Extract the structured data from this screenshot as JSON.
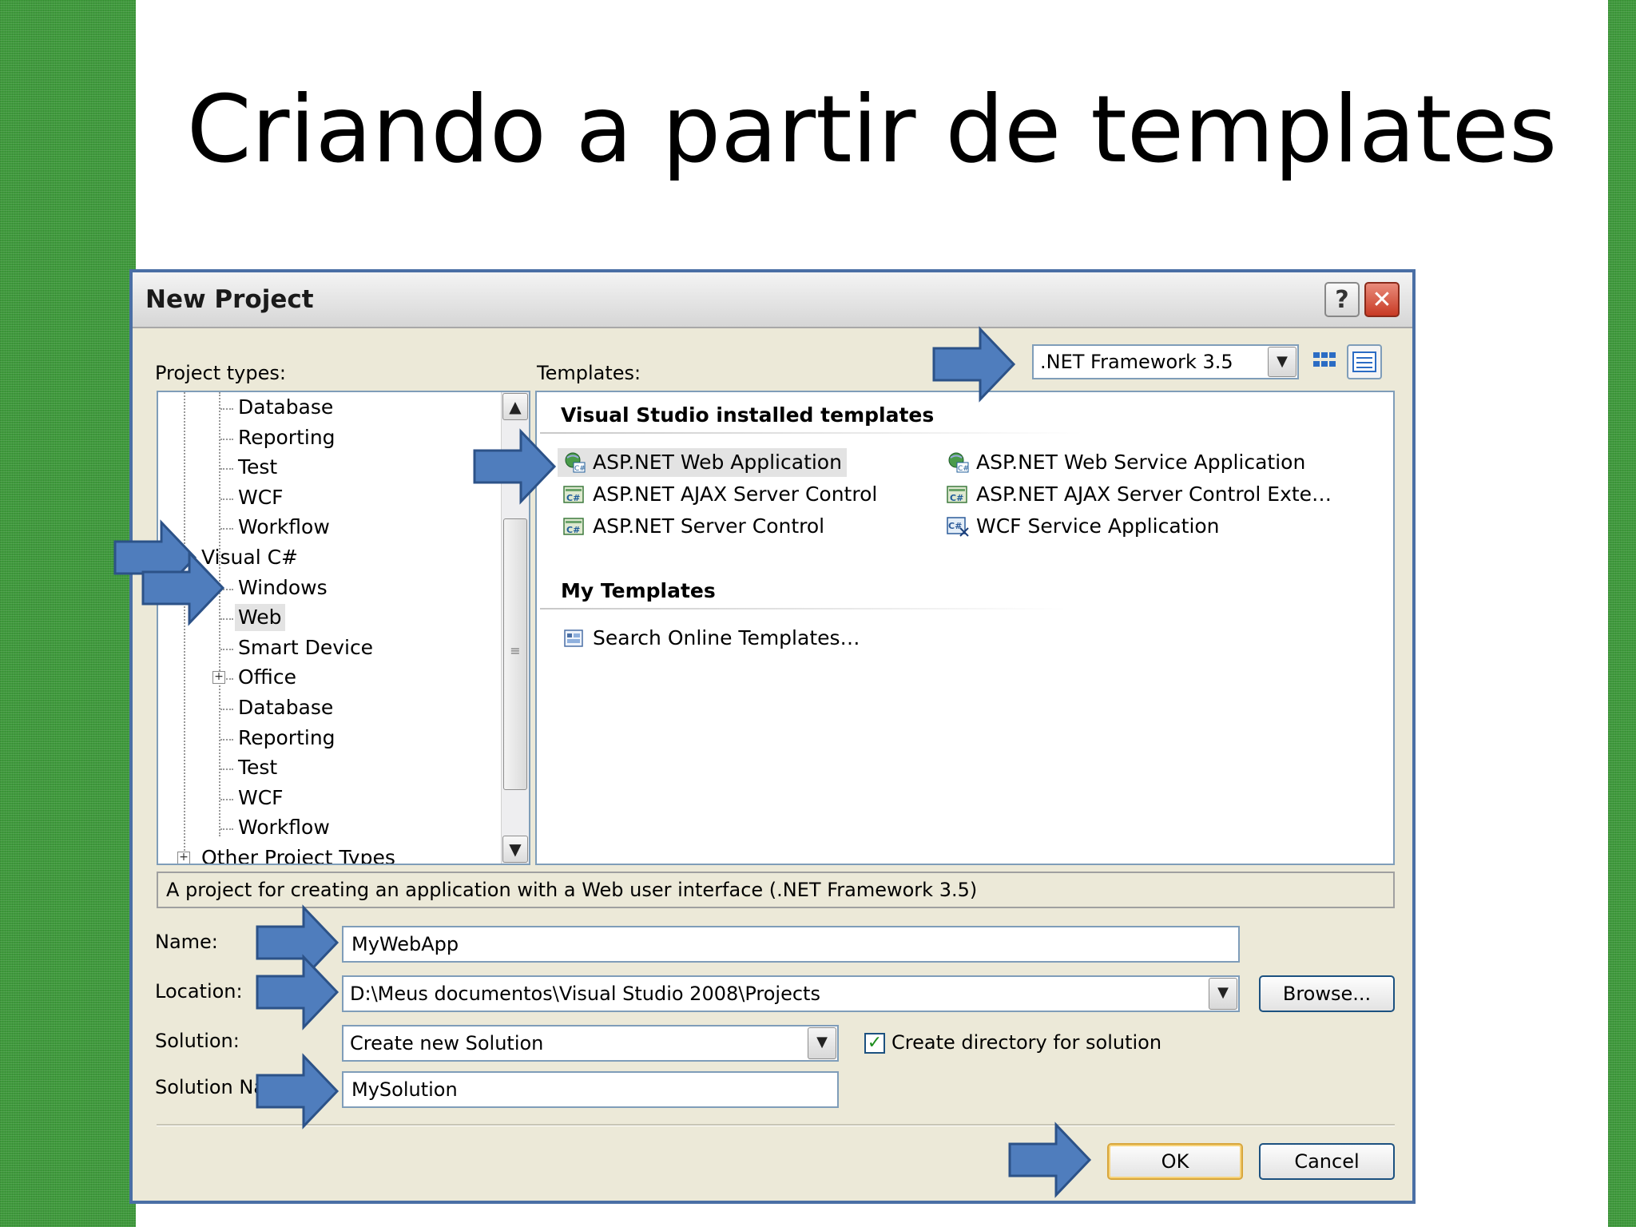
{
  "slide": {
    "title": "Criando a partir de templates"
  },
  "colors": {
    "slide_green": "#3f9a3c",
    "arrow_fill": "#4f7dbd",
    "arrow_stroke": "#2c5288",
    "window_bg": "#ece9d8"
  },
  "dialog": {
    "title": "New Project",
    "help_label": "?",
    "close_label": "✕",
    "project_types_label": "Project types:",
    "templates_label": "Templates:",
    "framework": {
      "value": ".NET Framework 3.5"
    },
    "tree": [
      {
        "label": "Database",
        "depth": 2
      },
      {
        "label": "Reporting",
        "depth": 2
      },
      {
        "label": "Test",
        "depth": 2
      },
      {
        "label": "WCF",
        "depth": 2
      },
      {
        "label": "Workflow",
        "depth": 2
      },
      {
        "label": "Visual C#",
        "depth": 1
      },
      {
        "label": "Windows",
        "depth": 2
      },
      {
        "label": "Web",
        "depth": 2,
        "selected": true
      },
      {
        "label": "Smart Device",
        "depth": 2
      },
      {
        "label": "Office",
        "depth": 2,
        "expander": "+"
      },
      {
        "label": "Database",
        "depth": 2
      },
      {
        "label": "Reporting",
        "depth": 2
      },
      {
        "label": "Test",
        "depth": 2
      },
      {
        "label": "WCF",
        "depth": 2
      },
      {
        "label": "Workflow",
        "depth": 2
      },
      {
        "label": "Other Project Types",
        "depth": 1,
        "expander": "+"
      }
    ],
    "installed_heading": "Visual Studio installed templates",
    "installed_templates": [
      {
        "label": "ASP.NET Web Application",
        "icon": "web-app-icon",
        "selected": true
      },
      {
        "label": "ASP.NET Web Service Application",
        "icon": "web-service-icon"
      },
      {
        "label": "ASP.NET AJAX Server Control",
        "icon": "server-control-icon"
      },
      {
        "label": "ASP.NET AJAX Server Control Exte…",
        "icon": "server-control-icon"
      },
      {
        "label": "ASP.NET Server Control",
        "icon": "server-control-icon"
      },
      {
        "label": "WCF Service Application",
        "icon": "wcf-service-icon"
      }
    ],
    "my_templates_heading": "My Templates",
    "my_templates": [
      {
        "label": "Search Online Templates…",
        "icon": "search-online-icon"
      }
    ],
    "description": "A project for creating an application with a Web user interface (.NET Framework 3.5)",
    "name_label": "Name:",
    "name_value": "MyWebApp",
    "location_label": "Location:",
    "location_value": "D:\\Meus documentos\\Visual Studio 2008\\Projects",
    "browse_label": "Browse...",
    "solution_label": "Solution:",
    "solution_value": "Create new Solution",
    "create_dir_label": "Create directory for solution",
    "create_dir_checked": true,
    "solution_name_label": "Solution Na",
    "solution_name_value": "MySolution",
    "ok_label": "OK",
    "cancel_label": "Cancel"
  }
}
